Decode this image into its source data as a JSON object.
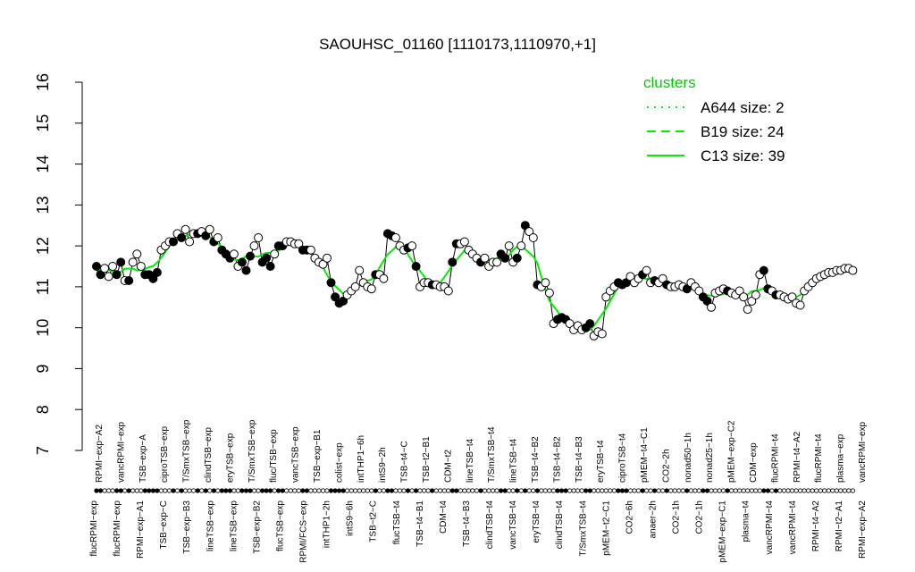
{
  "chart_data": {
    "type": "line",
    "title": "SAOUHSC_01160 [1110173,1110970,+1]",
    "ylim": [
      7,
      16
    ],
    "yticks": [
      7,
      8,
      9,
      10,
      11,
      12,
      13,
      14,
      15,
      16
    ],
    "legend": {
      "title": "clusters",
      "placement": "top-right",
      "entries": [
        {
          "label": "A644 size: 2",
          "style": "dotted"
        },
        {
          "label": "B19 size: 24",
          "style": "dashed"
        },
        {
          "label": "C13 size: 39",
          "style": "solid"
        }
      ]
    },
    "colors": {
      "line": "#00ee00",
      "point_edge": "#000000"
    },
    "top_labels": [
      "RPMI−exp−A2",
      "vancRPMI−exp",
      "TSB−exp−A",
      "ciproTSB−exp",
      "T/SmxTSB−exp",
      "clindTSB−exp",
      "eryTSB−exp",
      "T/SmxTSB−exp",
      "fluc/TSB−exp",
      "vancTSB−exp",
      "TSB−exp−B1",
      "colist−exp",
      "intTHP1−6h",
      "intS9−2h",
      "TSB−t4−C",
      "TSB−t2−B1",
      "CDM−t2",
      "lineTSB−t4",
      "T/SmxTSB−t4",
      "lineTSB−t4",
      "TSB−t4−B2",
      "TSB−t4−B2",
      "TSB−t4−B3",
      "eryTSB−t4",
      "ciproTSB−t4",
      "pMEM−t4−C1",
      "CO2−2h",
      "nonad50−1h",
      "nonad25−1h",
      "pMEM−exp−C2",
      "CDM−exp",
      "flucRPMI−t4",
      "RPMI−t4−A2",
      "flucRPMI−t4",
      "plasma−exp",
      "vancRPMI−exp"
    ],
    "bottom_labels": [
      "flucRPMI−exp",
      "flucRPMI−exp",
      "RPMI−exp−A1",
      "TSB−exp−C",
      "TSB−exp−B3",
      "lineTSB−exp",
      "lineTSB−exp",
      "TSB−exp−B2",
      "flucTSB−exp",
      "RPMI/FCS−exp",
      "intTHP1−2h",
      "intS9−6h",
      "TSB−t2−C",
      "flucTSB−t4",
      "TSB−t4−B1",
      "CDM−t4",
      "TSB−t4−B3",
      "clindTSB−t4",
      "vancTSB−t4",
      "eryTSB−t4",
      "clindTSB−t4",
      "T/SmxTSB−t4",
      "pMEM−t2−C1",
      "CO2−6h",
      "anaer−2h",
      "CO2−1h",
      "CO2−1h",
      "pMEM−exp−C1",
      "plasma−t4",
      "vancRPMI−t4",
      "vancRPMI−t4",
      "RPMI−t4−A2",
      "RPMI−t2−A1",
      "RPMI−exp−A2"
    ],
    "x": [
      1,
      2,
      3,
      4,
      5,
      6,
      7,
      8,
      9,
      10,
      11,
      12,
      13,
      14,
      15,
      16,
      17,
      18,
      19,
      20,
      21,
      22,
      23,
      24,
      25,
      26,
      27,
      28,
      29,
      30,
      31,
      32,
      33,
      34,
      35,
      36,
      37,
      38,
      39,
      40,
      41,
      42,
      43,
      44,
      45,
      46,
      47,
      48,
      49,
      50,
      51,
      52,
      53,
      54,
      55,
      56,
      57,
      58,
      59,
      60,
      61,
      62,
      63,
      64,
      65,
      66,
      67,
      68,
      69,
      70,
      71,
      72,
      73,
      74,
      75,
      76,
      77,
      78,
      79,
      80,
      81,
      82,
      83,
      84,
      85,
      86,
      87,
      88,
      89,
      90,
      91,
      92,
      93,
      94,
      95,
      96,
      97,
      98,
      99,
      100,
      101,
      102,
      103,
      104,
      105,
      106,
      107,
      108,
      109,
      110,
      111,
      112,
      113,
      114,
      115,
      116,
      117,
      118,
      119,
      120,
      121,
      122,
      123,
      124,
      125,
      126,
      127,
      128,
      129,
      130,
      131,
      132,
      133,
      134,
      135,
      136,
      137,
      138,
      139,
      140,
      141,
      142,
      143,
      144,
      145,
      146,
      147,
      148,
      149,
      150,
      151,
      152,
      153,
      154,
      155,
      156,
      157,
      158,
      159,
      160,
      161,
      162,
      163,
      164,
      165,
      166,
      167,
      168,
      169,
      170,
      171,
      172,
      173,
      174,
      175,
      176,
      177,
      178,
      179,
      180,
      181,
      182,
      183,
      184,
      185,
      186,
      187,
      188,
      189,
      190,
      191
    ],
    "series": [
      {
        "style": "solid",
        "values": [
          11.5,
          11.3,
          11.45,
          11.25,
          11.5,
          11.3,
          11.6,
          11.15,
          11.15,
          11.6,
          11.8,
          11.5,
          11.3,
          11.3,
          11.2,
          11.35,
          11.9,
          12.0,
          12.1,
          12.1,
          12.3,
          12.2,
          12.4,
          12.1,
          12.3,
          12.3,
          12.35,
          12.25,
          12.4,
          12.1,
          12.2,
          11.9,
          11.8,
          11.7,
          11.8,
          11.5,
          11.6,
          11.4,
          11.75,
          12.0,
          12.2,
          11.6,
          11.7,
          11.5,
          11.8,
          12.0,
          12.0,
          12.1,
          12.1,
          12.05,
          12.05,
          11.9,
          11.9,
          11.9,
          11.7,
          11.6,
          11.55,
          11.7,
          11.1,
          10.75,
          10.6,
          10.65,
          10.8,
          10.9,
          11.0,
          11.4,
          11.1,
          11.0,
          10.95,
          11.3,
          11.3,
          11.2,
          12.3,
          12.25,
          12.2,
          12.0,
          11.9,
          11.95,
          12.0,
          11.5,
          11.0,
          11.1,
          11.1,
          11.05,
          11.05,
          11.0,
          11.0,
          10.9,
          11.6,
          12.05,
          12.05,
          12.1,
          11.9,
          11.8,
          11.7,
          11.6,
          11.7,
          11.5,
          11.6,
          11.6,
          11.8,
          11.7,
          12.0,
          11.6,
          11.7,
          12.0,
          12.5,
          12.35,
          12.2,
          11.05,
          11.0,
          11.1,
          10.85,
          10.1,
          10.2,
          10.25,
          10.2,
          10.1,
          9.95,
          10.05,
          9.95,
          10.0,
          10.1,
          9.8,
          9.9,
          9.85,
          10.75,
          10.9,
          11.0,
          11.1,
          11.05,
          11.1,
          11.25,
          11.1,
          11.2,
          11.3,
          11.4,
          11.1,
          11.15,
          11.1,
          11.2,
          11.05,
          11.0,
          11.0,
          11.05,
          11.0,
          10.95,
          11.1,
          11.0,
          10.9,
          10.75,
          10.65,
          10.5,
          10.85,
          10.9,
          10.95,
          10.9,
          10.85,
          10.8,
          10.9,
          10.75,
          10.45,
          10.65,
          10.8,
          11.3,
          11.4,
          10.95,
          10.9,
          10.8,
          10.8,
          10.75,
          10.7,
          10.75,
          10.6,
          10.55,
          10.9,
          11.0,
          11.1,
          11.2,
          11.25,
          11.3,
          11.35,
          11.35,
          11.4,
          11.4,
          11.45,
          11.45,
          11.4
        ],
        "filled": [
          true,
          true,
          false,
          false,
          false,
          true,
          true,
          false,
          true,
          false,
          false,
          false,
          true,
          true,
          true,
          true,
          false,
          false,
          false,
          true,
          false,
          true,
          false,
          false,
          false,
          true,
          false,
          true,
          false,
          true,
          false,
          true,
          true,
          true,
          false,
          false,
          true,
          true,
          true,
          false,
          false,
          true,
          true,
          true,
          false,
          true,
          true,
          false,
          false,
          false,
          false,
          true,
          true,
          false,
          false,
          false,
          false,
          false,
          true,
          true,
          true,
          true,
          false,
          false,
          false,
          false,
          false,
          false,
          false,
          true,
          false,
          false,
          true,
          true,
          false,
          false,
          false,
          true,
          false,
          true,
          false,
          false,
          false,
          true,
          false,
          false,
          false,
          false,
          true,
          true,
          false,
          false,
          false,
          false,
          false,
          true,
          false,
          false,
          false,
          false,
          true,
          true,
          false,
          false,
          true,
          false,
          true,
          false,
          false,
          true,
          false,
          false,
          false,
          false,
          true,
          true,
          true,
          false,
          false,
          false,
          false,
          true,
          true,
          false,
          false,
          false,
          false,
          false,
          false,
          true,
          true,
          true,
          false,
          false,
          false,
          true,
          false,
          false,
          true,
          false,
          false,
          true,
          false,
          false,
          false,
          false,
          true,
          false,
          false,
          false,
          true,
          true,
          false,
          false,
          false,
          false,
          true,
          false,
          false,
          false,
          false,
          false,
          false,
          false,
          false,
          true,
          true,
          false,
          true,
          false,
          false,
          false,
          false,
          false,
          false,
          false,
          false,
          false,
          false,
          false,
          false,
          false,
          false,
          false,
          false,
          false,
          false,
          false,
          false,
          false,
          false
        ]
      }
    ]
  }
}
